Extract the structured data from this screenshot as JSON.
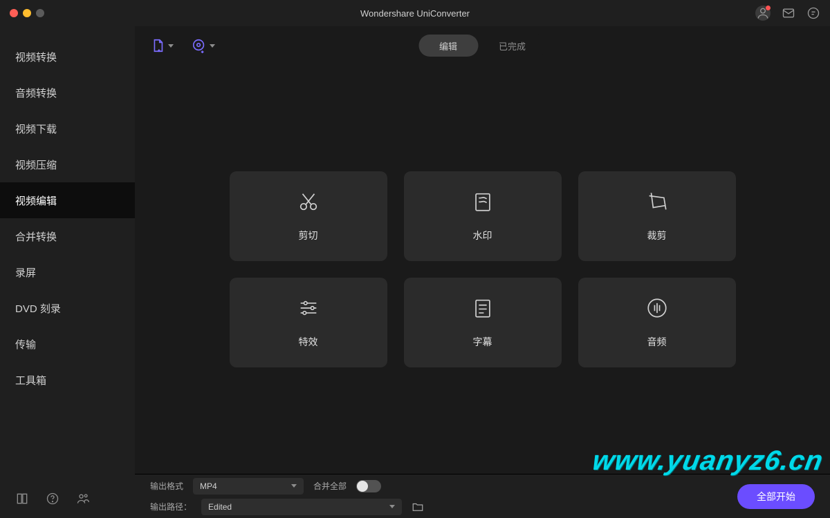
{
  "title": "Wondershare UniConverter",
  "sidebar": {
    "items": [
      {
        "label": "视频转换"
      },
      {
        "label": "音频转换"
      },
      {
        "label": "视频下载"
      },
      {
        "label": "视频压缩"
      },
      {
        "label": "视频编辑"
      },
      {
        "label": "合并转换"
      },
      {
        "label": "录屏"
      },
      {
        "label": "DVD 刻录"
      },
      {
        "label": "传输"
      },
      {
        "label": "工具箱"
      }
    ],
    "active_index": 4
  },
  "seg": {
    "tabs": [
      {
        "label": "编辑"
      },
      {
        "label": "已完成"
      }
    ],
    "active_index": 0
  },
  "cards": [
    {
      "label": "剪切",
      "icon": "scissors-icon"
    },
    {
      "label": "水印",
      "icon": "watermark-icon"
    },
    {
      "label": "裁剪",
      "icon": "crop-icon"
    },
    {
      "label": "特效",
      "icon": "sliders-icon"
    },
    {
      "label": "字幕",
      "icon": "subtitle-icon"
    },
    {
      "label": "音频",
      "icon": "audio-icon"
    }
  ],
  "footer": {
    "output_format_label": "输出格式",
    "output_format_value": "MP4",
    "merge_all_label": "合并全部",
    "output_path_label": "输出路径：",
    "output_path_value": "Edited",
    "start_button": "全部开始"
  },
  "watermark": "www.yuanyz6.cn"
}
